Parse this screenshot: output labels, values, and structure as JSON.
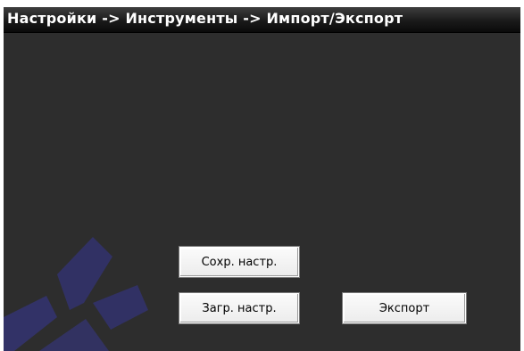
{
  "window": {
    "title": "Настройки -> Инструменты -> Импорт/Экспорт"
  },
  "buttons": {
    "save_settings": "Сохр. настр.",
    "load_settings": "Загр. настр.",
    "export": "Экспорт"
  },
  "colors": {
    "panel_background": "#2d2d2d",
    "title_bar": "#1a1a1a",
    "title_text": "#ffffff",
    "button_face": "#f0f0f0",
    "watermark": "#3a3a78"
  }
}
